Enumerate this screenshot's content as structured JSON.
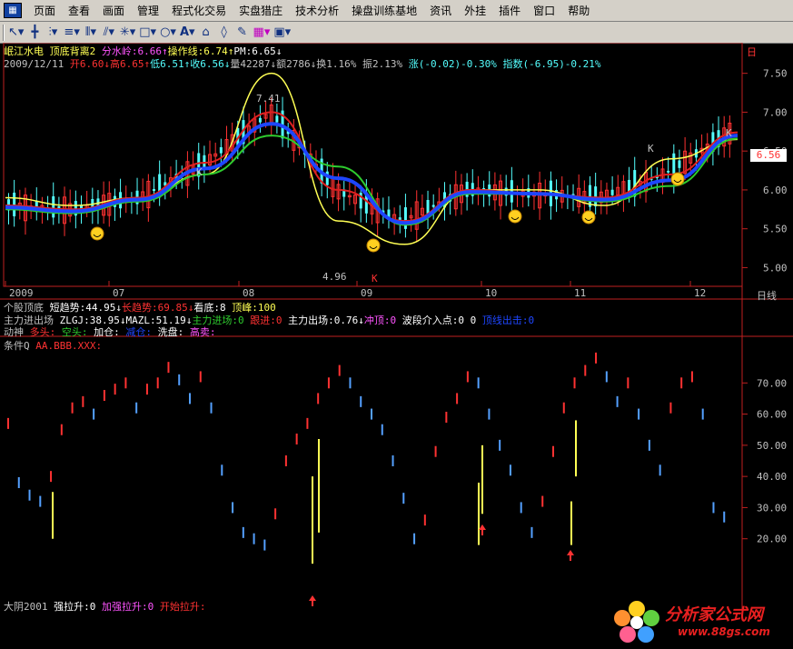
{
  "menubar": {
    "items": [
      "页面",
      "查看",
      "画面",
      "管理",
      "程式化交易",
      "实盘猎庄",
      "技术分析",
      "操盘训练基地",
      "资讯",
      "外挂",
      "插件",
      "窗口",
      "帮助"
    ]
  },
  "toolbar": {
    "icons": [
      "cursor-icon",
      "cross-icon",
      "bars-icon",
      "lines-icon",
      "fib-icon",
      "trend-icon",
      "rect-icon",
      "circle-icon",
      "text-icon",
      "gann-icon",
      "lock-icon",
      "eraser-icon",
      "pencil-icon",
      "color-icon",
      "save-icon"
    ]
  },
  "main_panel": {
    "title_line": "岷江水电 顶底背离2 分水岭:6.66↑操作线:6.74↑PM:6.65↓",
    "stock_name": "岷江水电",
    "indicator_name": "顶底背离2",
    "fenshuiling": "分水岭:6.66↑",
    "caozuoxian": "操作线:6.74↑",
    "pm": "PM:6.65↓",
    "quote_line": "2009/12/11 开6.60↓高6.65↑低6.51↑收6.56↓量42287↓额2786↓换1.16% 振2.13% 涨(-0.02)-0.30% 指数(-6.95)-0.21%",
    "date": "2009/12/11",
    "open": "开6.60↓",
    "high": "高6.65↑",
    "low": "低6.51↑",
    "close": "收6.56↓",
    "volume": "量42287↓",
    "amount": "额2786↓",
    "turnover": "换1.16%",
    "amplitude": "振2.13%",
    "change": "涨(-0.02)-0.30%",
    "index_change": "指数(-6.95)-0.21%",
    "price_ticks": [
      "7.50",
      "7.00",
      "6.50",
      "6.00",
      "5.50",
      "5.00"
    ],
    "current_price": "6.56",
    "high_label": "7.41",
    "low_label": "4.96",
    "k_labels": [
      "K",
      "K",
      "K",
      "K"
    ],
    "top_mark": "日",
    "period_label": "日线",
    "x_ticks": [
      "2009",
      "07",
      "08",
      "09",
      "10",
      "11",
      "12"
    ]
  },
  "sub_panel": {
    "line1": "个股顶底 短趋势:44.95↓长趋势:69.85↓看底:8 顶峰:100",
    "line1_parts": [
      "个股顶底",
      "短趋势:44.95↓",
      "长趋势:69.85↓",
      "看底:8",
      "顶峰:100"
    ],
    "line2": "主力进出场 ZLGJ:38.95↓MAZL:51.19↓主力进场:0 跟进:0 主力出场:0.76↓冲顶:0 波段介入点:0 0 顶线出击:0",
    "line2_parts": [
      "主力进出场",
      "ZLGJ:38.95↓",
      "MAZL:51.19↓",
      "主力进场:0",
      "跟进:0",
      "主力出场:0.76↓",
      "冲顶:0",
      "波段介入点:0 0",
      "顶线出击:0"
    ],
    "line3_parts": [
      "动神",
      "多头:",
      "空头:",
      "加仓:",
      "减仓:",
      "洗盘:",
      "高卖:"
    ],
    "line4": "条件Q AA.BBB.XXX:",
    "line4_parts": [
      "条件Q",
      "AA.BBB.XXX:"
    ],
    "ticks": [
      "70.00",
      "60.00",
      "50.00",
      "40.00",
      "30.00",
      "20.00"
    ],
    "bottom_line_parts": [
      "大阴2001",
      "强拉升:0",
      "加强拉升:0",
      "开始拉升:"
    ]
  },
  "watermark": {
    "text": "分析家公式网",
    "url": "www.88gs.com"
  },
  "colors": {
    "up": "#ff3232",
    "down": "#54ffff",
    "bg": "#000000",
    "axis": "#c02020",
    "yellow": "#ffff54",
    "blue": "#1e46ff",
    "green": "#2ecc2e"
  },
  "chart_data": [
    {
      "type": "line",
      "title": "岷江水电 顶底背离2",
      "x": [
        "2009",
        "07",
        "08",
        "09",
        "10",
        "11",
        "12"
      ],
      "ylim": [
        4.9,
        7.8
      ],
      "series": [
        {
          "name": "分水岭",
          "values": [
            5.75,
            5.7,
            5.85,
            6.2,
            6.7,
            6.3,
            5.55,
            5.95,
            5.95,
            5.85,
            6.05,
            6.66
          ]
        },
        {
          "name": "操作线",
          "values": [
            5.8,
            5.75,
            5.9,
            6.35,
            7.0,
            6.0,
            5.6,
            6.0,
            5.95,
            5.9,
            6.2,
            6.74
          ]
        },
        {
          "name": "PM",
          "values": [
            5.9,
            5.8,
            5.9,
            6.2,
            7.5,
            5.6,
            5.3,
            6.0,
            6.0,
            5.8,
            6.4,
            6.65
          ]
        }
      ]
    },
    {
      "type": "bar",
      "title": "条件Q AA.BBB.XXX",
      "ylim": [
        10,
        80
      ],
      "values": [
        57,
        38,
        34,
        32,
        40,
        55,
        62,
        64,
        60,
        66,
        68,
        70,
        62,
        68,
        70,
        75,
        71,
        65,
        72,
        62,
        42,
        30,
        22,
        20,
        18,
        28,
        45,
        52,
        57,
        65,
        70,
        74,
        70,
        64,
        60,
        55,
        45,
        33,
        20,
        26,
        48,
        59,
        65,
        72,
        70,
        60,
        50,
        42,
        30,
        22,
        32,
        48,
        62,
        70,
        74,
        78,
        72,
        64,
        70,
        60,
        50,
        42,
        62,
        70,
        72,
        60,
        30,
        27
      ]
    }
  ]
}
